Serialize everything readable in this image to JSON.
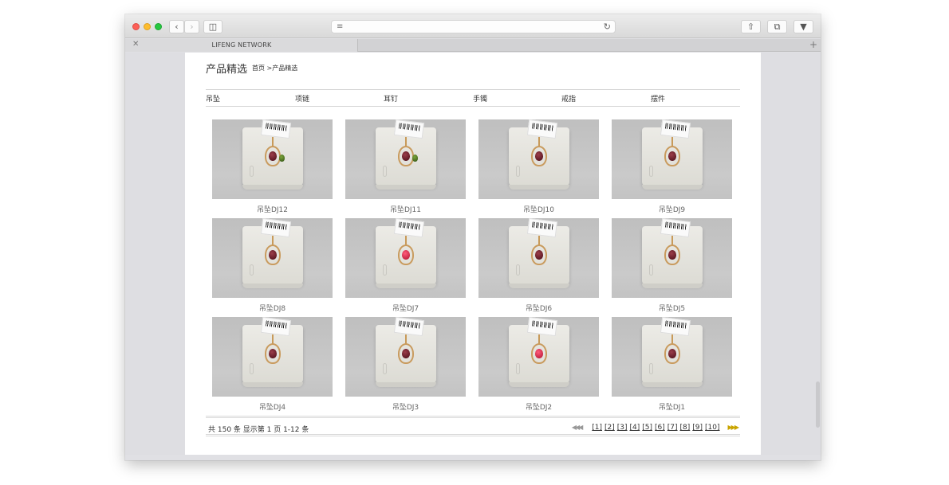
{
  "browser": {
    "tab_title": "LIFENG NETWORK",
    "colors": {
      "close": "#fc5f57",
      "minimize": "#fdbd2e",
      "zoom": "#27c840"
    }
  },
  "header": {
    "title": "产品精选",
    "breadcrumb": "首页 >产品精选"
  },
  "categories": [
    "吊坠",
    "项链",
    "耳钉",
    "手镯",
    "戒指",
    "摆件"
  ],
  "products": [
    {
      "name": "吊坠DJ12",
      "stone": "dark",
      "accent": "green"
    },
    {
      "name": "吊坠DJ11",
      "stone": "dark",
      "accent": "green"
    },
    {
      "name": "吊坠DJ10",
      "stone": "dark"
    },
    {
      "name": "吊坠DJ9",
      "stone": "dark"
    },
    {
      "name": "吊坠DJ8",
      "stone": "dark"
    },
    {
      "name": "吊坠DJ7",
      "stone": "pink"
    },
    {
      "name": "吊坠DJ6",
      "stone": "dark"
    },
    {
      "name": "吊坠DJ5",
      "stone": "dark"
    },
    {
      "name": "吊坠DJ4",
      "stone": "dark"
    },
    {
      "name": "吊坠DJ3",
      "stone": "dark"
    },
    {
      "name": "吊坠DJ2",
      "stone": "pink"
    },
    {
      "name": "吊坠DJ1",
      "stone": "dark"
    }
  ],
  "pagination": {
    "summary": "共 150 条 显示第 1 页 1-12 条",
    "prev": "◀◀◀",
    "pages": [
      "[1]",
      "[2]",
      "[3]",
      "[4]",
      "[5]",
      "[6]",
      "[7]",
      "[8]",
      "[9]",
      "[10]"
    ],
    "next": "▶▶▶"
  },
  "icons": [
    "back-icon",
    "forward-icon",
    "sidebar-icon",
    "reader-icon",
    "reload-icon",
    "share-icon",
    "tabs-icon",
    "download-icon",
    "close-tab-icon",
    "new-tab-icon"
  ]
}
